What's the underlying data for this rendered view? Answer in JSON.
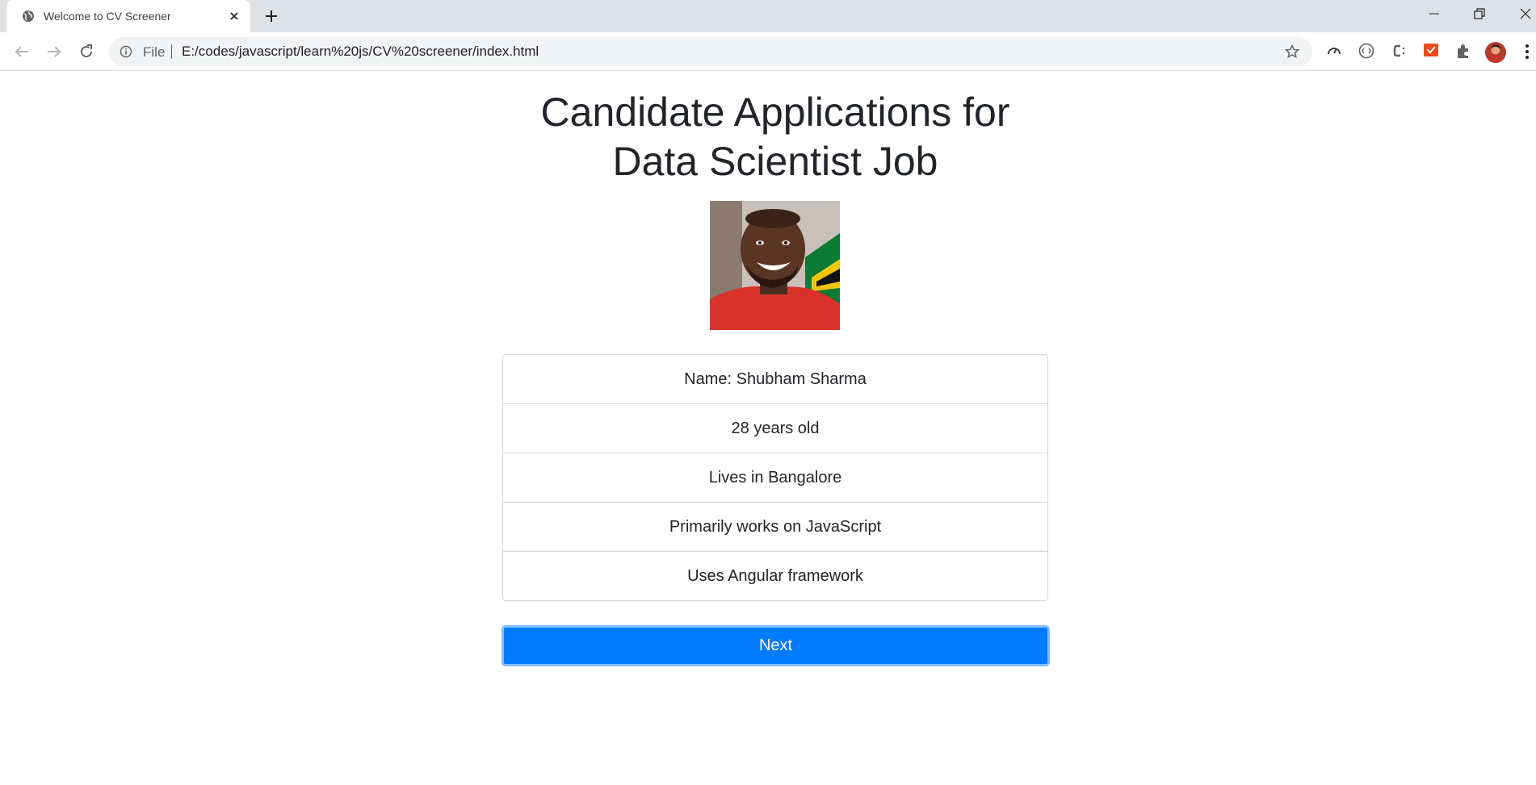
{
  "browser": {
    "tab_title": "Welcome to CV Screener",
    "file_label": "File",
    "url": "E:/codes/javascript/learn%20js/CV%20screener/index.html",
    "extension_badge": "off"
  },
  "page": {
    "heading_line1": "Candidate Applications for",
    "heading_line2": "Data Scientist Job",
    "candidate": {
      "name": "Name: Shubham Sharma",
      "age": "28 years old",
      "city": "Lives in Bangalore",
      "language": "Primarily works on JavaScript",
      "framework": "Uses Angular framework"
    },
    "next_label": "Next"
  },
  "colors": {
    "primary": "#007bff",
    "primary_focus_ring": "#80bdff",
    "text": "#212529",
    "tabstrip": "#dee1e6"
  }
}
